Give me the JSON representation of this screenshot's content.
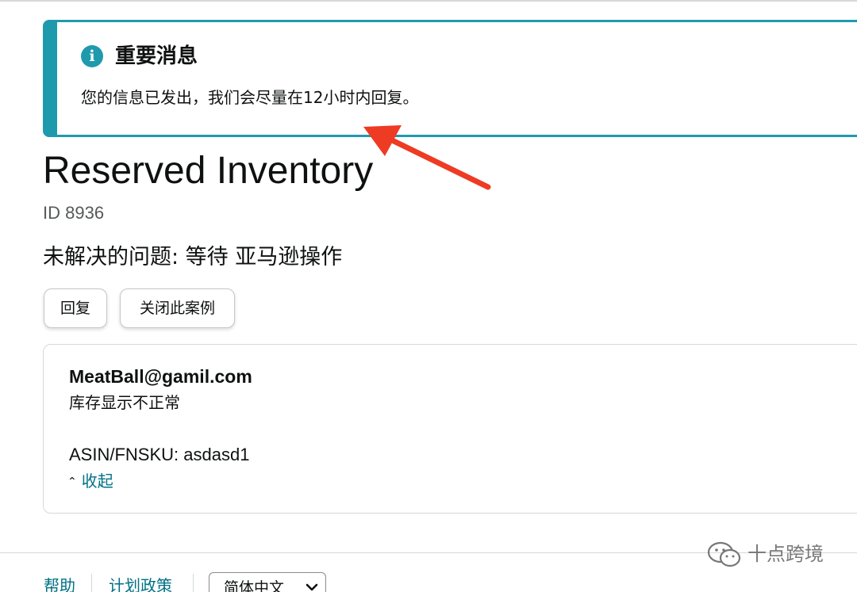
{
  "alert": {
    "icon": "info-icon",
    "icon_glyph": "i",
    "title": "重要消息",
    "body": "您的信息已发出，我们会尽量在12小时内回复。",
    "accent_color": "#1f9aad"
  },
  "annotation": {
    "icon": "red-arrow-annotation",
    "color": "#ee3b24"
  },
  "page": {
    "title": "Reserved Inventory",
    "case_id": "ID 8936",
    "status": "未解决的问题:  等待  亚马逊操作"
  },
  "actions": {
    "reply_label": "回复",
    "close_case_label": "关闭此案例"
  },
  "message": {
    "sender": "MeatBall@gamil.com",
    "subject": "库存显示不正常",
    "asin_line": "ASIN/FNSKU: asdasd1",
    "collapse_icon": "chevron-up-icon",
    "collapse_label": "收起",
    "link_color": "#007185"
  },
  "footer": {
    "help_label": "帮助",
    "policy_label": "计划政策",
    "language_selected": "简体中文",
    "language_icon": "chevron-down-icon"
  },
  "watermark": {
    "logo_icon": "wechat-logo-icon",
    "text": "十点跨境"
  }
}
